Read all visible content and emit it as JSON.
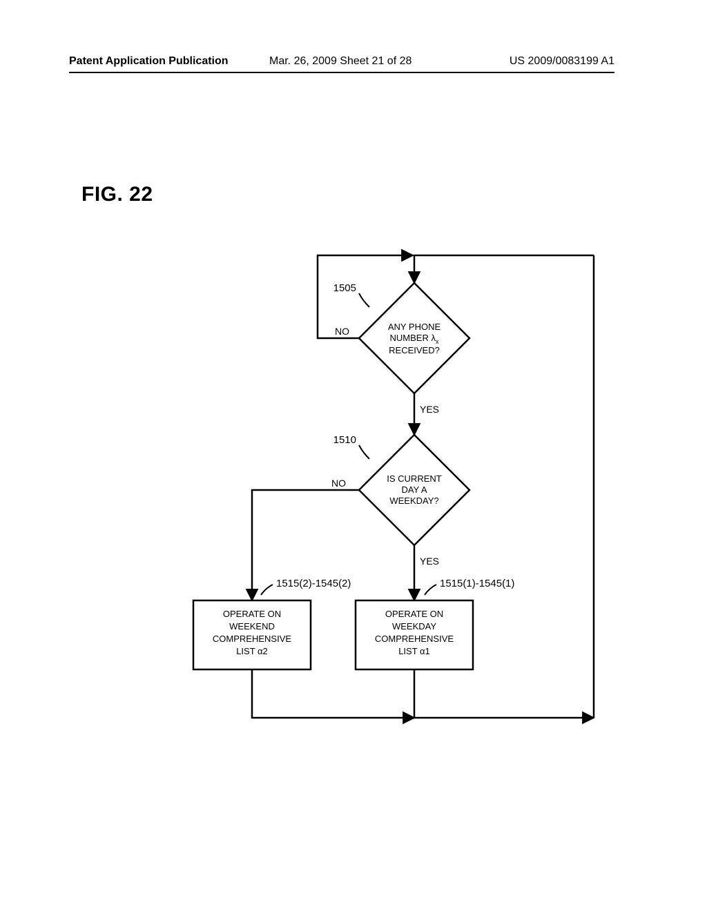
{
  "header": {
    "left": "Patent Application Publication",
    "mid": "Mar. 26, 2009  Sheet 21 of 28",
    "right": "US 2009/0083199 A1"
  },
  "figure_title": "FIG. 22",
  "labels": {
    "ref_1505": "1505",
    "ref_1510": "1510",
    "ref_weekend": "1515(2)-1545(2)",
    "ref_weekday": "1515(1)-1545(1)",
    "no": "NO",
    "yes": "YES"
  },
  "decision1": {
    "l1": "ANY PHONE",
    "l2": "NUMBER λ",
    "sub": "x",
    "l3": "RECEIVED?"
  },
  "decision2": {
    "l1": "IS CURRENT",
    "l2": "DAY A",
    "l3": "WEEKDAY?"
  },
  "proc_weekend": {
    "l1": "OPERATE ON",
    "l2": "WEEKEND",
    "l3": "COMPREHENSIVE",
    "l4": "LIST α2"
  },
  "proc_weekday": {
    "l1": "OPERATE ON",
    "l2": "WEEKDAY",
    "l3": "COMPREHENSIVE",
    "l4": "LIST α1"
  },
  "chart_data": {
    "type": "flowchart",
    "nodes": [
      {
        "id": "1505",
        "kind": "decision",
        "text": "ANY PHONE NUMBER λx RECEIVED?"
      },
      {
        "id": "1510",
        "kind": "decision",
        "text": "IS CURRENT DAY A WEEKDAY?"
      },
      {
        "id": "weekend",
        "kind": "process",
        "ref": "1515(2)-1545(2)",
        "text": "OPERATE ON WEEKEND COMPREHENSIVE LIST α2"
      },
      {
        "id": "weekday",
        "kind": "process",
        "ref": "1515(1)-1545(1)",
        "text": "OPERATE ON WEEKDAY COMPREHENSIVE LIST α1"
      }
    ],
    "edges": [
      {
        "from": "entry",
        "to": "1505"
      },
      {
        "from": "1505",
        "to": "1505",
        "label": "NO",
        "loop": true
      },
      {
        "from": "1505",
        "to": "1510",
        "label": "YES"
      },
      {
        "from": "1510",
        "to": "weekend",
        "label": "NO"
      },
      {
        "from": "1510",
        "to": "weekday",
        "label": "YES"
      },
      {
        "from": "weekend",
        "to": "exit"
      },
      {
        "from": "weekday",
        "to": "exit"
      }
    ]
  }
}
